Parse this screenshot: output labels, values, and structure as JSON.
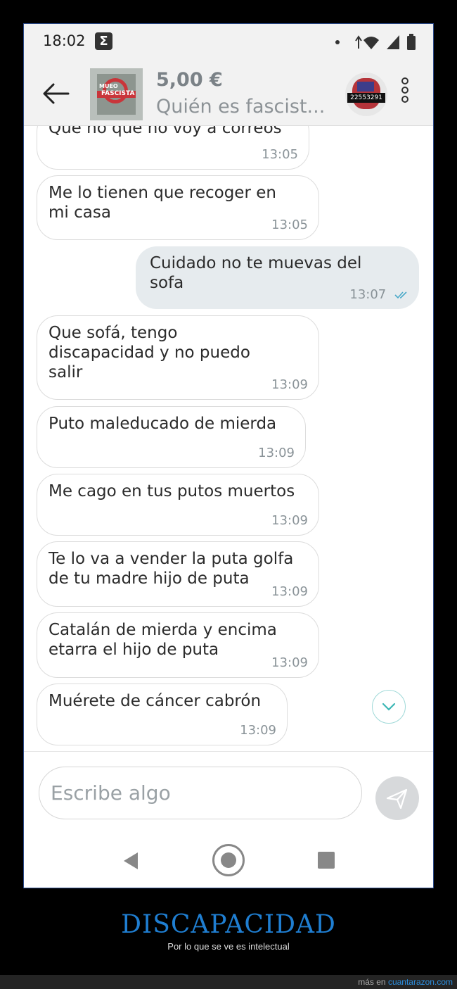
{
  "status": {
    "time": "18:02"
  },
  "header": {
    "price": "5,00 €",
    "title": "Quién es fascist...",
    "thumb_words": [
      "MUEO",
      "FASCISTA"
    ],
    "seller_badge": "22553291"
  },
  "messages": [
    {
      "dir": "in",
      "text": "Que no que no voy a correos",
      "time": "13:05"
    },
    {
      "dir": "in",
      "text": "Me lo tienen que recoger en\nmi casa",
      "time": "13:05"
    },
    {
      "dir": "out",
      "text": "Cuidado no te muevas del\nsofa",
      "time": "13:07"
    },
    {
      "dir": "in",
      "text": "Que sofá, tengo\ndiscapacidad y no puedo\nsalir",
      "time": "13:09"
    },
    {
      "dir": "in",
      "text": "Puto maleducado de mierda",
      "time": "13:09"
    },
    {
      "dir": "in",
      "text": "Me cago en tus putos muertos",
      "time": "13:09"
    },
    {
      "dir": "in",
      "text": "Te lo va a vender la puta golfa\nde tu madre hijo de puta",
      "time": "13:09"
    },
    {
      "dir": "in",
      "text": "Catalán de mierda y encima\netarra el hijo de puta",
      "time": "13:09"
    },
    {
      "dir": "in",
      "text": "Muérete de cáncer cabrón",
      "time": "13:09"
    }
  ],
  "composer": {
    "placeholder": "Escribe algo"
  },
  "caption": {
    "title": "DISCAPACIDAD",
    "subtitle": "Por lo que se ve es intelectual"
  },
  "footer": {
    "prefix": "más en",
    "link": "cuantarazon.com"
  },
  "colors": {
    "caption_blue": "#1f7ed1",
    "read_ticks": "#4aa9c9",
    "accent_teal": "#9fd9d8"
  },
  "icons": [
    "sigma-icon",
    "wifi-icon",
    "signal-icon",
    "battery-icon",
    "back-arrow-icon",
    "kebab-menu-icon",
    "chevron-down-icon",
    "send-icon",
    "nav-back-icon",
    "nav-home-icon",
    "nav-recents-icon",
    "double-check-icon"
  ]
}
